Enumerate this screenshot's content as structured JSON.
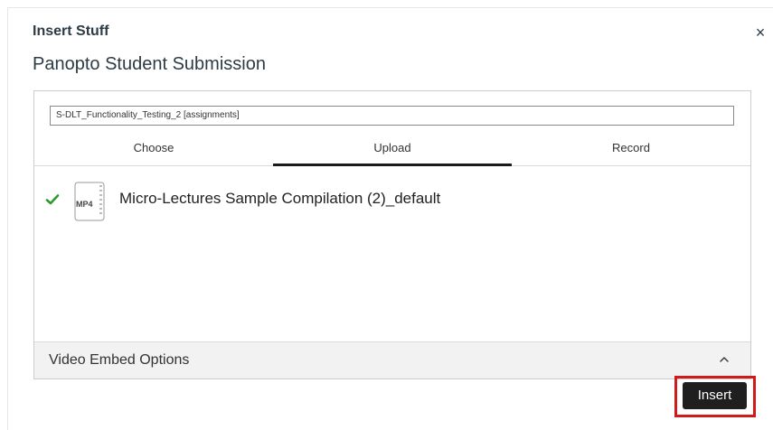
{
  "dialog": {
    "title": "Insert Stuff",
    "close_label": "×",
    "subtitle": "Panopto Student Submission"
  },
  "folder": {
    "value": "S-DLT_Functionality_Testing_2 [assignments]"
  },
  "tabs": [
    {
      "label": "Choose",
      "active": false
    },
    {
      "label": "Upload",
      "active": true
    },
    {
      "label": "Record",
      "active": false
    }
  ],
  "file": {
    "status_icon": "check-icon",
    "type_label": "MP4",
    "name": "Micro-Lectures Sample Compilation (2)_default"
  },
  "embed_options": {
    "label": "Video Embed Options",
    "icon": "caret-up-icon"
  },
  "actions": {
    "insert_label": "Insert"
  },
  "colors": {
    "accent_tab_underline": "#1a1a1a",
    "success_check": "#2e9a2e",
    "highlight_border": "#d11a1a",
    "insert_button_bg": "#1f1f1f"
  }
}
